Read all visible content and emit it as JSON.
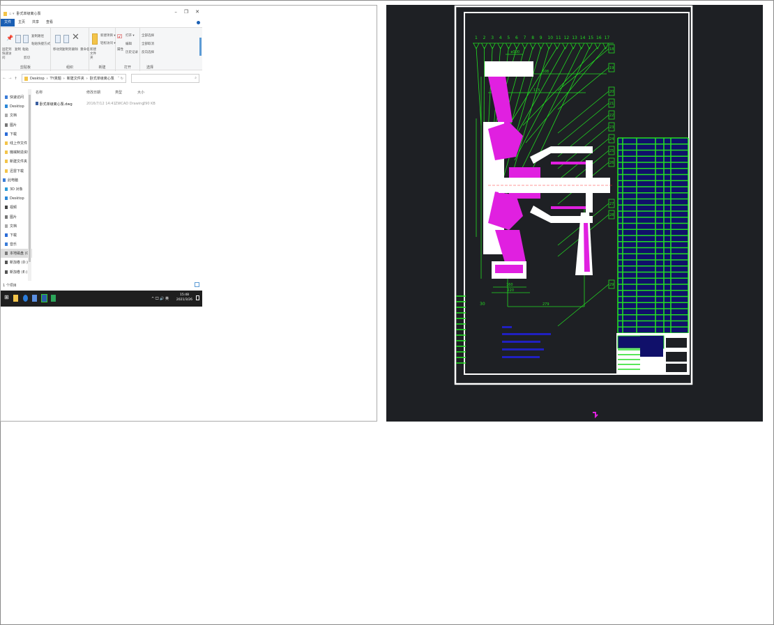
{
  "explorer": {
    "title": "卧式单级离心泵",
    "window_controls": [
      "–",
      "❐",
      "✕"
    ],
    "tabs": [
      "文件",
      "主页",
      "共享",
      "查看"
    ],
    "ribbon": {
      "clipboard": {
        "pin": "固定到快速访问",
        "copy": "复制",
        "paste": "粘贴",
        "copy_path": "复制路径",
        "paste_shortcut": "粘贴快捷方式",
        "cut": "剪切",
        "label": "剪贴板"
      },
      "organize": {
        "move_to": "移动到",
        "copy_to": "复制到",
        "delete": "删除",
        "rename": "重命名",
        "label": "组织"
      },
      "new": {
        "new_folder": "新建文件夹",
        "new_item": "新建项目 ▾",
        "easy_access": "轻松访问 ▾",
        "label": "新建"
      },
      "open": {
        "properties": "属性",
        "open": "打开 ▾",
        "edit": "编辑",
        "history": "历史记录",
        "label": "打开"
      },
      "select": {
        "select_all": "全部选择",
        "select_none": "全部取消",
        "invert": "反向选择",
        "label": "选择"
      }
    },
    "address": {
      "path": [
        "Desktop",
        "TY真题",
        "新建文件夹",
        "卧式单级离心泵"
      ],
      "search_placeholder": ""
    },
    "sidebar": {
      "items": [
        "快速访问",
        "Desktop",
        "文档",
        "图片",
        "下载",
        "线上作文件",
        "機械制造资料",
        "新建文件夹",
        "迅雷下载",
        "此电脑",
        "3D 对象",
        "Desktop",
        "视频",
        "图片",
        "文档",
        "下载",
        "音乐",
        "本地磁盘 (C:)",
        "新加卷 (D:)",
        "新加卷 (E:)"
      ]
    },
    "columns": [
      "名称",
      "修改日期",
      "类型",
      "大小"
    ],
    "files": [
      {
        "name": "卧式单级离心泵.dwg",
        "modified": "2016/7/12 14:41",
        "type": "ZWCAD Drawing",
        "size": "290 KB"
      }
    ],
    "status": "1 个项目",
    "taskbar": {
      "time": "15:48",
      "date": "2021/3/26",
      "tray": "^ 🖵 🔊 英"
    }
  },
  "cad": {
    "balloons_top": [
      "1",
      "2",
      "3",
      "4",
      "5",
      "6",
      "7",
      "8",
      "9",
      "10",
      "11",
      "12",
      "13",
      "14",
      "15",
      "16",
      "17"
    ],
    "balloons_right": [
      "18",
      "19",
      "20",
      "21",
      "22",
      "23",
      "24",
      "25",
      "26",
      "27",
      "28",
      "29"
    ],
    "balloon_left": "30",
    "dimensions": [
      "ø300",
      "508",
      "279",
      "160",
      "220",
      "115"
    ],
    "colors": {
      "background": "#1e2024",
      "frame": "#ffffff",
      "lines": "#22dd22",
      "section": "#e020e0",
      "text": "#2020c0"
    }
  }
}
